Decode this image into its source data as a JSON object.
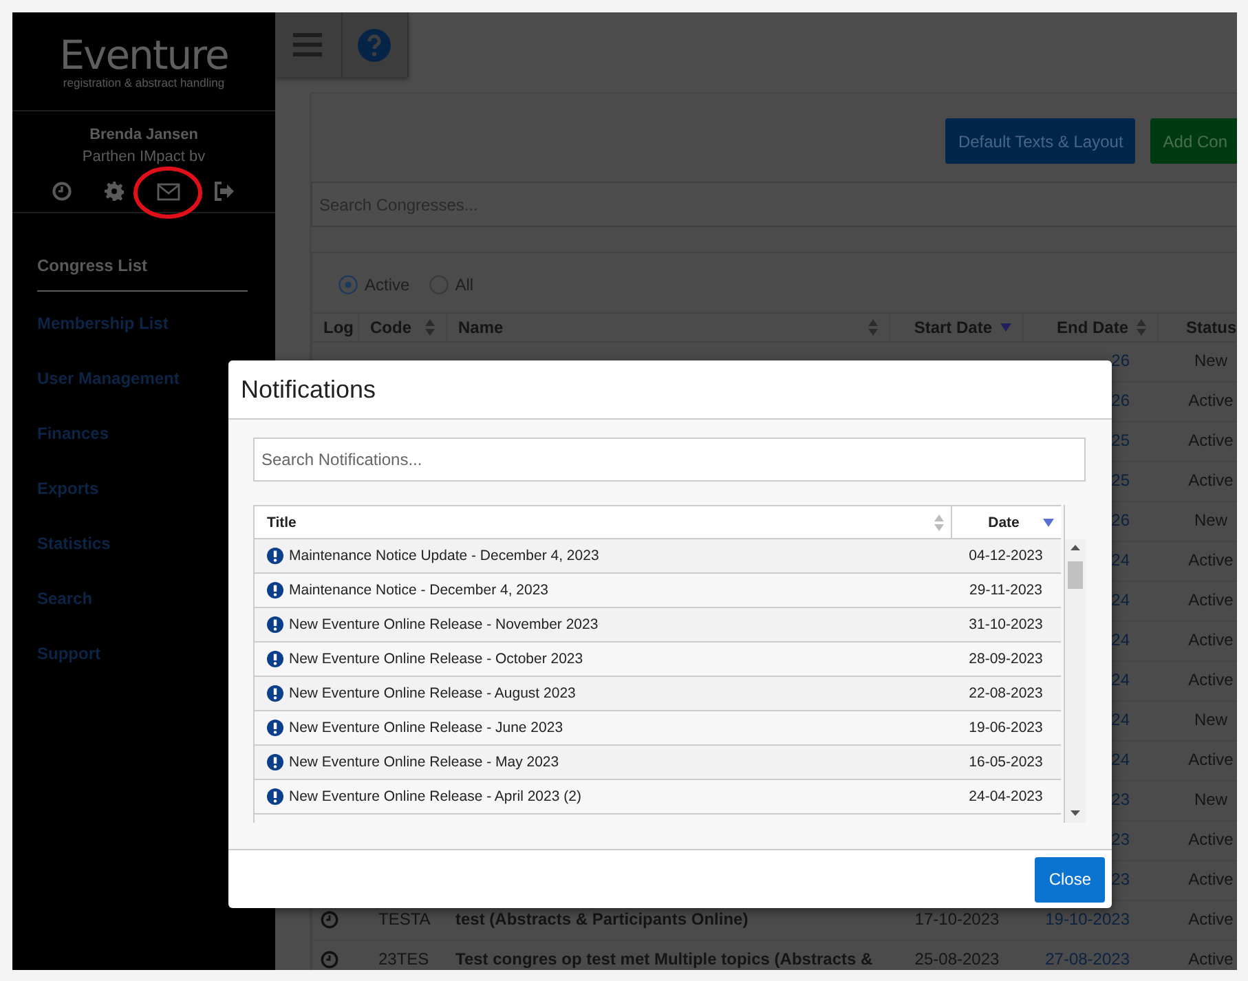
{
  "sidebar": {
    "logo": {
      "title": "Eventure",
      "tagline": "registration & abstract handling"
    },
    "user": {
      "name": "Brenda Jansen",
      "company": "Parthen IMpact bv"
    },
    "nav": [
      {
        "label": "Congress List",
        "selected": true
      },
      {
        "label": "Membership List",
        "selected": false
      },
      {
        "label": "User Management",
        "selected": false
      },
      {
        "label": "Finances",
        "selected": false
      },
      {
        "label": "Exports",
        "selected": false
      },
      {
        "label": "Statistics",
        "selected": false
      },
      {
        "label": "Search",
        "selected": false
      },
      {
        "label": "Support",
        "selected": false
      }
    ]
  },
  "congress_page": {
    "buttons": [
      {
        "label": "Default Texts & Layout",
        "kind": "primary"
      },
      {
        "label": "Add Con",
        "kind": "success"
      }
    ],
    "search": {
      "placeholder": "Search Congresses..."
    },
    "filter": [
      {
        "label": "Active",
        "selected": true
      },
      {
        "label": "All",
        "selected": false
      }
    ],
    "table": {
      "columns": [
        {
          "label": "Log",
          "sortable": false,
          "sorted": false
        },
        {
          "label": "Code",
          "sortable": true,
          "sorted": false
        },
        {
          "label": "Name",
          "sortable": true,
          "sorted": false
        },
        {
          "label": "Start Date",
          "sortable": true,
          "sorted": true
        },
        {
          "label": "End Date",
          "sortable": true,
          "sorted": false
        },
        {
          "label": "Status",
          "sortable": false,
          "sorted": false
        }
      ],
      "rows": [
        {
          "end_date": "26",
          "status": "New"
        },
        {
          "end_date": "26",
          "status": "Active"
        },
        {
          "end_date": "25",
          "status": "Active"
        },
        {
          "end_date": "25",
          "status": "Active"
        },
        {
          "end_date": "26",
          "status": "New"
        },
        {
          "end_date": "24",
          "status": "Active"
        },
        {
          "end_date": "24",
          "status": "Active"
        },
        {
          "end_date": "24",
          "status": "Active"
        },
        {
          "end_date": "24",
          "status": "Active"
        },
        {
          "end_date": "24",
          "status": "New"
        },
        {
          "end_date": "24",
          "status": "Active"
        },
        {
          "end_date": "23",
          "status": "New"
        },
        {
          "end_date": "23",
          "status": "Active"
        },
        {
          "end_date": "23",
          "status": "Active"
        },
        {
          "log": true,
          "code": "TESTA",
          "name": "test (Abstracts & Participants Online)",
          "start_date": "17-10-2023",
          "end_date": "19-10-2023",
          "status": "Active"
        },
        {
          "log": true,
          "code": "23TES",
          "name": "Test congres op test met Multiple topics (Abstracts &",
          "start_date": "25-08-2023",
          "end_date": "27-08-2023",
          "status": "Active"
        }
      ]
    }
  },
  "notifications_dialog": {
    "title": "Notifications",
    "search": {
      "placeholder": "Search Notifications..."
    },
    "table": {
      "columns": [
        {
          "label": "Title",
          "sortable": true,
          "sorted": false
        },
        {
          "label": "Date",
          "sortable": true,
          "sorted": true
        }
      ],
      "rows": [
        {
          "title": "Maintenance Notice Update - December 4, 2023",
          "date": "04-12-2023"
        },
        {
          "title": "Maintenance Notice - December 4, 2023",
          "date": "29-11-2023"
        },
        {
          "title": "New Eventure Online Release - November 2023",
          "date": "31-10-2023"
        },
        {
          "title": "New Eventure Online Release - October 2023",
          "date": "28-09-2023"
        },
        {
          "title": "New Eventure Online Release - August 2023",
          "date": "22-08-2023"
        },
        {
          "title": "New Eventure Online Release - June 2023",
          "date": "19-06-2023"
        },
        {
          "title": "New Eventure Online Release - May 2023",
          "date": "16-05-2023"
        },
        {
          "title": "New Eventure Online Release - April 2023 (2)",
          "date": "24-04-2023"
        }
      ]
    },
    "close_button": "Close"
  }
}
